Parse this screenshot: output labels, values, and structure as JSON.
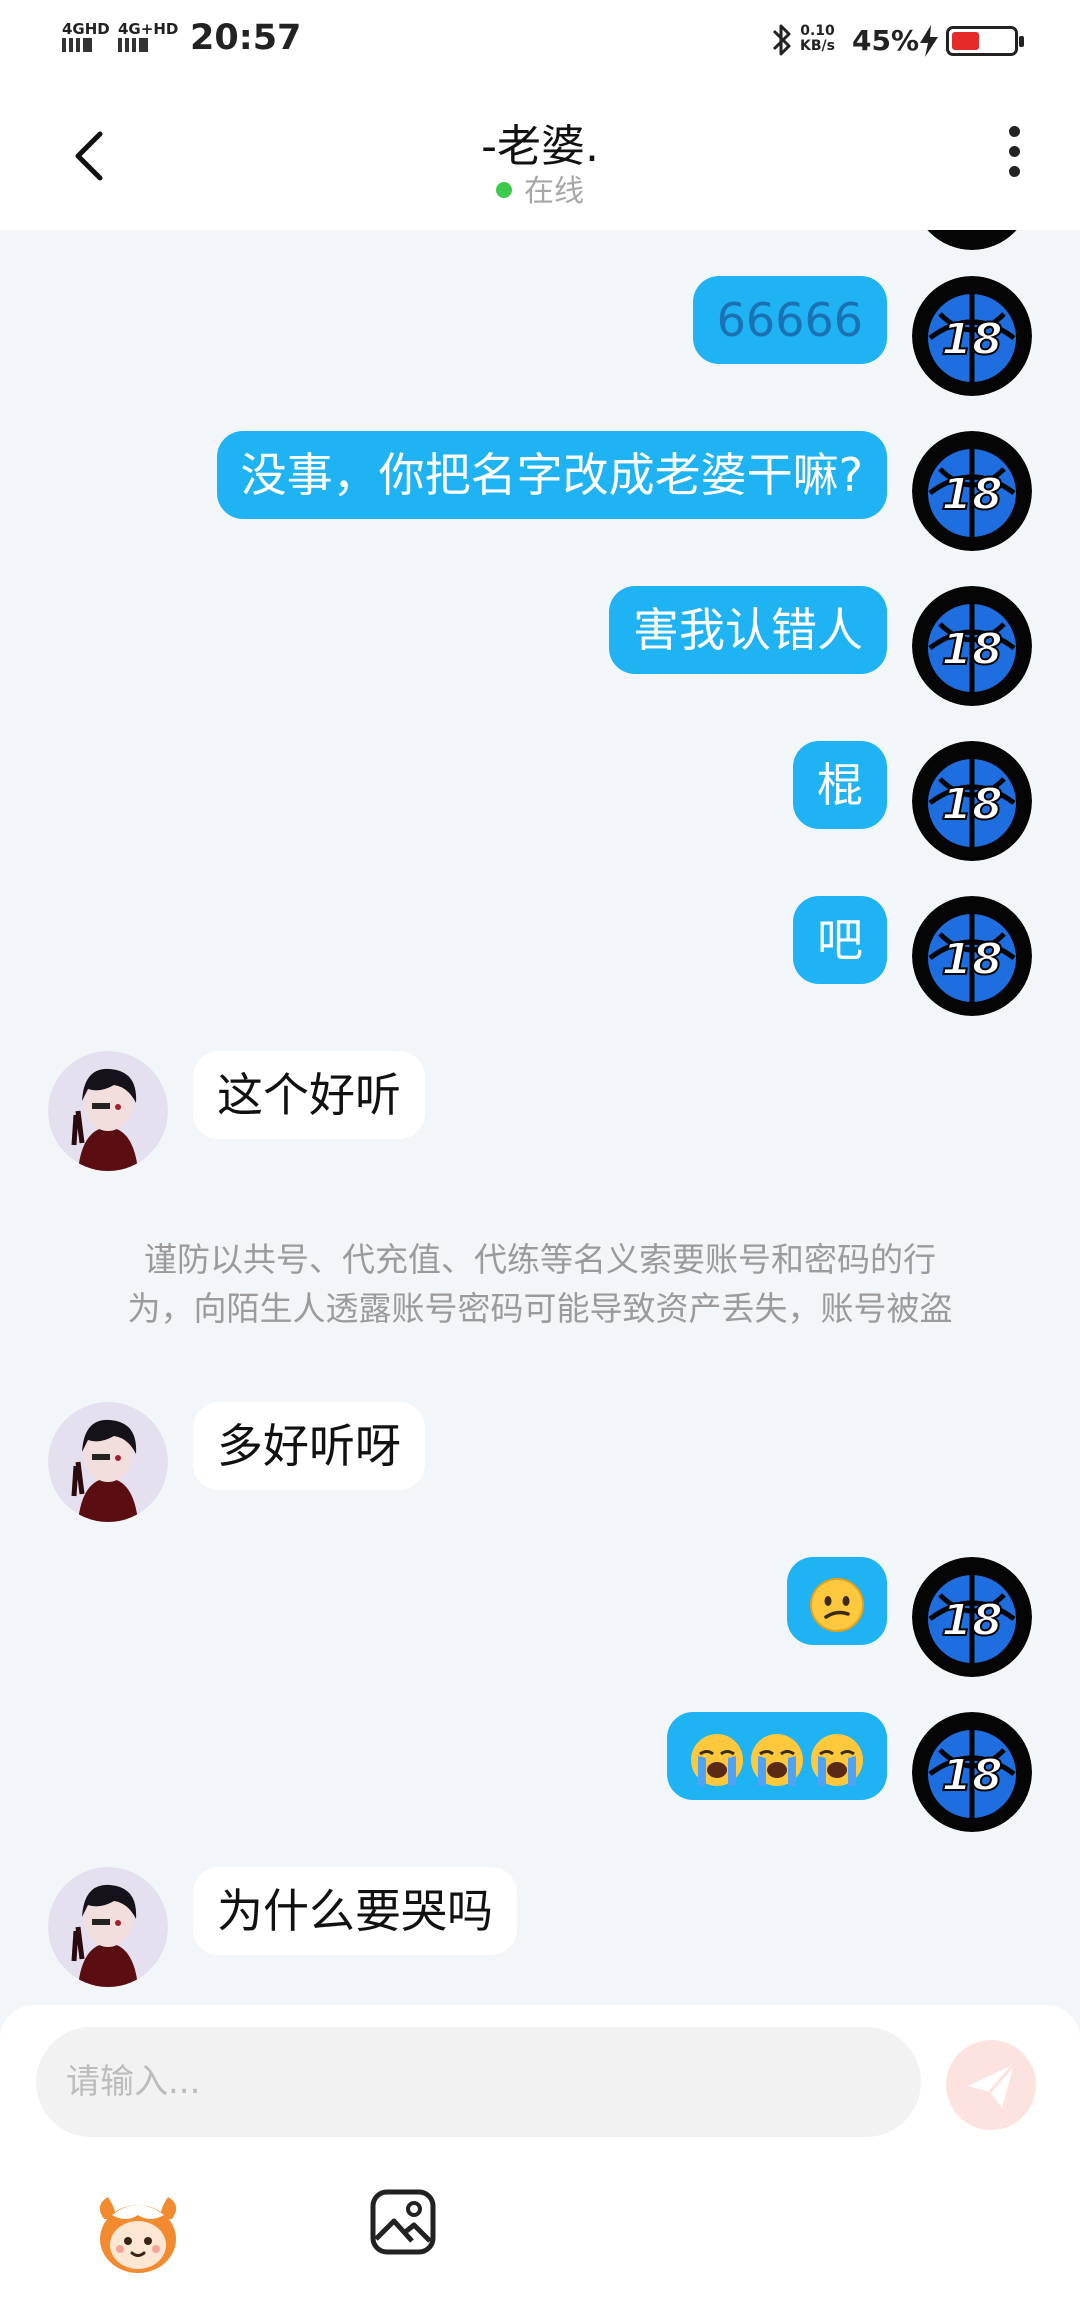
{
  "status_bar": {
    "signal_1": "4GHD",
    "signal_2": "4G+HD",
    "time": "20:57",
    "net_speed_value": "0.10",
    "net_speed_unit": "KB/s",
    "battery_percent": "45%",
    "battery_level": 0.45,
    "icons": [
      "bluetooth-icon",
      "charging-bolt-icon",
      "battery-icon"
    ]
  },
  "header": {
    "title": "-老婆.",
    "status": "在线",
    "icons": [
      "back-icon",
      "more-icon"
    ]
  },
  "messages": [
    {
      "side": "out",
      "text": "66666"
    },
    {
      "side": "out",
      "text": "没事，你把名字改成老婆干嘛?"
    },
    {
      "side": "out",
      "text": "害我认错人"
    },
    {
      "side": "out",
      "text": "棍"
    },
    {
      "side": "out",
      "text": "吧"
    },
    {
      "side": "in",
      "text": "这个好听"
    },
    {
      "side": "in",
      "text": "多好听呀"
    },
    {
      "side": "out",
      "emoji": [
        "confused-face"
      ]
    },
    {
      "side": "out",
      "emoji": [
        "loudly-crying-face",
        "loudly-crying-face",
        "loudly-crying-face"
      ]
    },
    {
      "side": "in",
      "text": "为什么要哭吗"
    }
  ],
  "notice": {
    "line1": "谨防以共号、代充值、代练等名义索要账号和密码的行",
    "line2": "为，向陌生人透露账号密码可能导致资产丢失，账号被盗"
  },
  "composer": {
    "placeholder": "请输入...",
    "icons": [
      "send-icon",
      "mascot-icon",
      "image-icon"
    ]
  },
  "colors": {
    "outgoing_bubble": "#1fb3f4",
    "incoming_bubble": "#ffffff",
    "chat_background": "#f3f6f9",
    "online_dot": "#3dc94a",
    "send_button": "#fde3e0"
  }
}
